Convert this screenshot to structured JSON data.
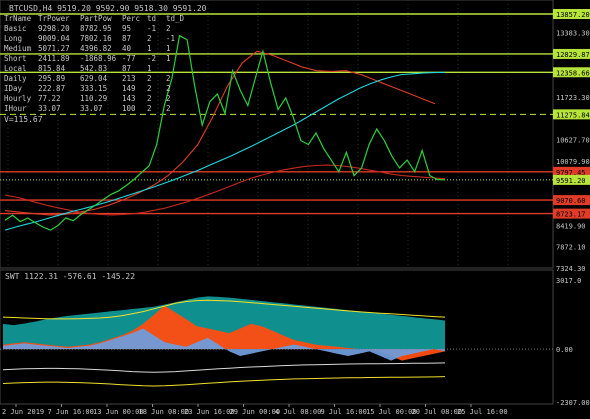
{
  "chart_data": [
    {
      "type": "line",
      "title": "BTCUSD,H4  9519.20 9592.90 9518.30 9591.20",
      "price_range": [
        7324.3,
        13857.2
      ],
      "price_ticks": [
        {
          "label": "13857.20",
          "value": 13857.2
        },
        {
          "label": "13383.30",
          "value": 13383.3
        },
        {
          "label": "12829.87",
          "value": 12829.87
        },
        {
          "label": "12358.66",
          "value": 12358.66
        },
        {
          "label": "11723.30",
          "value": 11723.3
        },
        {
          "label": "11275.84",
          "value": 11275.84
        },
        {
          "label": "10627.70",
          "value": 10627.7
        },
        {
          "label": "10079.90",
          "value": 10079.9
        },
        {
          "label": "9797.45",
          "value": 9797.45
        },
        {
          "label": "9591.20",
          "value": 9591.2
        },
        {
          "label": "9070.60",
          "value": 9070.6
        },
        {
          "label": "8723.17",
          "value": 8723.17
        },
        {
          "label": "8419.90",
          "value": 8419.9
        },
        {
          "label": "7872.10",
          "value": 7872.1
        },
        {
          "label": "7324.30",
          "value": 7324.3
        }
      ],
      "level_lines": [
        {
          "value": 13857.2,
          "color": "#b7e43a",
          "style": "solid",
          "marked": true
        },
        {
          "value": 12829.87,
          "color": "#b7e43a",
          "style": "solid",
          "marked": true
        },
        {
          "value": 12358.66,
          "color": "#b7e43a",
          "style": "solid",
          "marked": true
        },
        {
          "value": 11275.84,
          "color": "#b7e43a",
          "style": "dashed",
          "marked": true
        },
        {
          "value": 9797.45,
          "color": "#e03c28",
          "style": "solid",
          "marked": true
        },
        {
          "value": 9591.2,
          "color": "#b7e43a",
          "style": "dotted",
          "marked": true
        },
        {
          "value": 9070.6,
          "color": "#e03c28",
          "style": "solid",
          "marked": true
        },
        {
          "value": 8723.17,
          "color": "#e03c28",
          "style": "solid",
          "marked": true
        }
      ],
      "x_labels": [
        "2 Jun 2019",
        "7 Jun 16:00",
        "13 Jun 00:00",
        "18 Jun 08:00",
        "23 Jun 16:00",
        "29 Jun 00:00",
        "4 Jul 08:00",
        "9 Jul 16:00",
        "15 Jul 00:00",
        "20 Jul 08:00",
        "25 Jul 16:00"
      ],
      "series": [
        {
          "color": "#2bd13c",
          "values": [
            8550,
            8680,
            8520,
            8610,
            8490,
            8380,
            8300,
            8420,
            8610,
            8540,
            8700,
            8820,
            8950,
            9090,
            9220,
            9310,
            9450,
            9600,
            9780,
            9950,
            10500,
            11500,
            12200,
            13300,
            13200,
            12000,
            11000,
            11600,
            11800,
            11300,
            12400,
            11900,
            11500,
            12200,
            12900,
            12100,
            11400,
            11700,
            11200,
            10600,
            10500,
            10800,
            10400,
            10100,
            9800,
            10300,
            9700,
            9900,
            10500,
            10900,
            10600,
            10200,
            9900,
            10100,
            9800,
            10350,
            9700,
            9600,
            9591.2
          ]
        },
        {
          "color": "#1fd8e0",
          "values": [
            8300,
            8380,
            8450,
            8520,
            8600,
            8680,
            8760,
            8830,
            8900,
            8980,
            9060,
            9150,
            9240,
            9330,
            9420,
            9520,
            9620,
            9730,
            9840,
            9960,
            10080,
            10200,
            10330,
            10460,
            10600,
            10740,
            10880,
            11020,
            11180,
            11340,
            11500,
            11660,
            11800,
            11940,
            12060,
            12160,
            12240,
            12300,
            12320,
            12340,
            12350,
            12358
          ]
        },
        {
          "color": "#c8281e",
          "values": [
            9200,
            9150,
            9080,
            9000,
            8930,
            8870,
            8810,
            8760,
            8720,
            8700,
            8690,
            8700,
            8720,
            8760,
            8810,
            8870,
            8950,
            9030,
            9120,
            9220,
            9320,
            9430,
            9540,
            9640,
            9720,
            9790,
            9850,
            9900,
            9940,
            9960,
            9970,
            9960,
            9930,
            9890,
            9840,
            9790,
            9740,
            9700,
            9680,
            9660,
            9640,
            9620
          ]
        },
        {
          "color": "#e03c28",
          "values": [
            8800,
            8760,
            8720,
            8690,
            8700,
            8760,
            8830,
            8940,
            9080,
            9250,
            9450,
            9700,
            10050,
            10500,
            11200,
            12000,
            12600,
            12900,
            12800,
            12650,
            12500,
            12400,
            12380,
            12400,
            12300,
            12150,
            12000,
            11850,
            11700,
            11550
          ]
        }
      ]
    },
    {
      "type": "area",
      "title": "SWT 1122.31 -576.61 -145.22",
      "y_ticks": [
        {
          "label": "3017.0",
          "value": 3017.0
        },
        {
          "label": "0.00",
          "value": 0
        },
        {
          "label": "-2307.00",
          "value": -2307.0
        }
      ],
      "range": [
        -2307.0,
        3017.0
      ],
      "series": [
        {
          "color": "#13a8a8",
          "values": [
            1100,
            1050,
            1120,
            1200,
            1300,
            1380,
            1450,
            1500,
            1550,
            1600,
            1650,
            1700,
            1750,
            1800,
            1850,
            1950,
            2050,
            2150,
            2250,
            2300,
            2280,
            2250,
            2200,
            2150,
            2100,
            2050,
            2000,
            1950,
            1900,
            1850,
            1800,
            1750,
            1700,
            1650,
            1600,
            1550,
            1500,
            1450,
            1400,
            1350,
            1300,
            1250
          ]
        },
        {
          "color": "#ff4d10",
          "values": [
            200,
            250,
            300,
            250,
            200,
            150,
            100,
            150,
            200,
            300,
            450,
            600,
            800,
            1100,
            1500,
            1900,
            1600,
            1300,
            1000,
            900,
            800,
            700,
            900,
            1100,
            1000,
            800,
            600,
            400,
            300,
            200,
            150,
            100,
            50,
            0,
            -50,
            -100,
            -300,
            -500,
            -400,
            -300,
            -200,
            -100
          ]
        },
        {
          "color": "#6f9bd9",
          "values": [
            150,
            200,
            250,
            200,
            150,
            100,
            50,
            100,
            150,
            250,
            400,
            550,
            700,
            900,
            600,
            300,
            200,
            100,
            300,
            500,
            200,
            -100,
            -300,
            -200,
            -100,
            0,
            100,
            200,
            100,
            0,
            -100,
            -200,
            -300,
            -200,
            -100,
            -300,
            -500,
            -300,
            -200,
            -100,
            0,
            -100
          ]
        },
        {
          "color": "#f0e12a",
          "values": [
            1400,
            1380,
            1360,
            1340,
            1330,
            1320,
            1320,
            1330,
            1340,
            1360,
            1400,
            1460,
            1540,
            1640,
            1760,
            1880,
            2000,
            2080,
            2120,
            2130,
            2120,
            2100,
            2070,
            2030,
            1990,
            1950,
            1910,
            1870,
            1830,
            1790,
            1750,
            1710,
            1670,
            1630,
            1600,
            1570,
            1540,
            1510,
            1480,
            1450,
            1420,
            1400
          ]
        },
        {
          "color": "#f0e12a",
          "values": [
            -1500,
            -1480,
            -1460,
            -1450,
            -1440,
            -1440,
            -1450,
            -1460,
            -1480,
            -1500,
            -1520,
            -1550,
            -1580,
            -1600,
            -1610,
            -1600,
            -1580,
            -1550,
            -1520,
            -1490,
            -1460,
            -1430,
            -1400,
            -1380,
            -1360,
            -1340,
            -1320,
            -1300,
            -1290,
            -1280,
            -1270,
            -1260,
            -1250,
            -1245,
            -1240,
            -1235,
            -1230,
            -1225,
            -1220,
            -1215,
            -1210,
            -1200
          ]
        },
        {
          "color": "#d8d8d8",
          "values": [
            -900,
            -880,
            -860,
            -850,
            -840,
            -840,
            -850,
            -860,
            -880,
            -900,
            -920,
            -950,
            -980,
            -1000,
            -1010,
            -1000,
            -980,
            -950,
            -920,
            -890,
            -860,
            -830,
            -800,
            -780,
            -760,
            -740,
            -720,
            -700,
            -690,
            -680,
            -670,
            -660,
            -650,
            -645,
            -640,
            -635,
            -630,
            -625,
            -620,
            -615,
            -610,
            -600
          ]
        }
      ]
    }
  ],
  "table": {
    "headers": [
      "TrName",
      "TrPower",
      "PartPow",
      "Perc",
      "td",
      "td_D"
    ],
    "rows": [
      [
        "Basic",
        "9298.20",
        "8782.95",
        "95",
        "-1",
        "2"
      ],
      [
        "Long",
        "9009.04",
        "7802.16",
        "87",
        "2",
        "-1"
      ],
      [
        "Medium",
        "5071.27",
        "4396.82",
        "40",
        "1",
        "1"
      ],
      [
        "Short",
        "2411.89",
        "-1868.96",
        "-77",
        "-2",
        "1"
      ],
      [
        "Local",
        "815.84",
        "542.83",
        "87",
        "1",
        ""
      ],
      [
        "Daily",
        "295.89",
        "629.04",
        "213",
        "2",
        "2"
      ],
      [
        "IDay",
        "222.87",
        "333.15",
        "149",
        "2",
        "2"
      ],
      [
        "Hourly",
        "77.22",
        "110.29",
        "143",
        "2",
        "2"
      ],
      [
        "IHour",
        "33.07",
        "33.07",
        "100",
        "2",
        "2"
      ]
    ],
    "v_label": "V=115.67"
  },
  "colors": {
    "background": "#000000",
    "grid": "#1f2f1f",
    "text": "#c8c8c8",
    "level_green": "#b7e43a",
    "level_red": "#e03c28"
  }
}
